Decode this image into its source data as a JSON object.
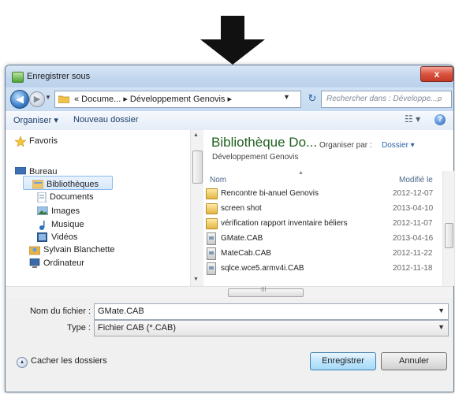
{
  "window": {
    "title": "Enregistrer sous",
    "close_label": "x"
  },
  "navigation": {
    "back_glyph": "◀",
    "forward_glyph": "▶",
    "history_glyph": "▼",
    "address_path": "« Docume... ▸ Développement Genovis ▸",
    "refresh_glyph": "↻",
    "search_placeholder": "Rechercher dans : Développe...",
    "search_glyph": "⌕"
  },
  "toolbar": {
    "organiser": "Organiser ▾",
    "new_folder": "Nouveau dossier",
    "views_glyph": "☷ ▾",
    "help_glyph": "?"
  },
  "sidebar": {
    "items": [
      {
        "label": "Favoris",
        "icon": "star-icon"
      },
      {
        "label": "Bureau",
        "icon": "desktop-icon"
      },
      {
        "label": "Bibliothèques",
        "icon": "libraries-icon"
      },
      {
        "label": "Documents",
        "icon": "documents-icon",
        "selected": true
      },
      {
        "label": "Images",
        "icon": "images-icon"
      },
      {
        "label": "Musique",
        "icon": "music-icon"
      },
      {
        "label": "Vidéos",
        "icon": "videos-icon"
      },
      {
        "label": "Sylvain Blanchette",
        "icon": "user-icon"
      },
      {
        "label": "Ordinateur",
        "icon": "computer-icon"
      }
    ]
  },
  "library": {
    "title": "Bibliothèque Do...",
    "subtitle": "Développement Genovis",
    "arrange_label": "Organiser par :",
    "arrange_value": "Dossier ▾",
    "columns": {
      "name": "Nom",
      "modified": "Modifié le"
    },
    "files": [
      {
        "name": "Rencontre bi-anuel Genovis",
        "date": "2012-12-07",
        "type": "folder"
      },
      {
        "name": "screen shot",
        "date": "2013-04-10",
        "type": "folder"
      },
      {
        "name": "vérification rapport inventaire béliers",
        "date": "2012-11-07",
        "type": "folder"
      },
      {
        "name": "GMate.CAB",
        "date": "2013-04-16",
        "type": "cab"
      },
      {
        "name": "MateCab.CAB",
        "date": "2012-11-22",
        "type": "cab"
      },
      {
        "name": "sqlce.wce5.armv4i.CAB",
        "date": "2012-11-18",
        "type": "cab"
      }
    ]
  },
  "form": {
    "filename_label": "Nom du fichier :",
    "filename_value": "GMate.CAB",
    "type_label": "Type :",
    "type_value": "Fichier CAB (*.CAB)"
  },
  "footer": {
    "hide_folders": "Cacher les dossiers",
    "save": "Enregistrer",
    "cancel": "Annuler"
  },
  "colors": {
    "library_title": "#1e5f1e",
    "link": "#2a62a6",
    "close_button": "#d9533f"
  }
}
